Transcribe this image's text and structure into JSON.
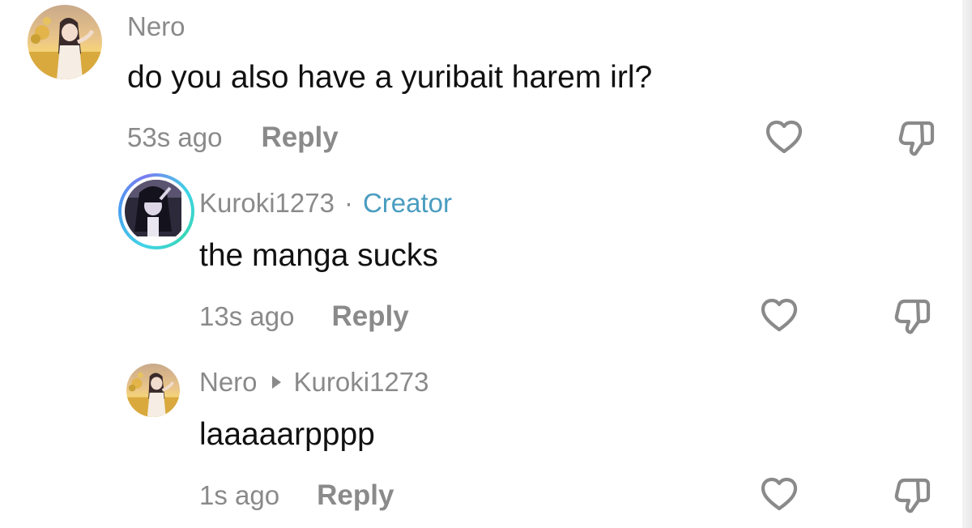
{
  "comments": [
    {
      "username": "Nero",
      "text": "do you also have a yuribait harem irl?",
      "time": "53s ago",
      "reply_label": "Reply",
      "avatar_icon": "anime-girl-sunset-avatar",
      "like_icon": "heart-outline-icon",
      "dislike_icon": "thumbs-down-outline-icon"
    },
    {
      "username": "Kuroki1273",
      "separator": "·",
      "badge": "Creator",
      "text": "the manga sucks",
      "time": "13s ago",
      "reply_label": "Reply",
      "avatar_icon": "anime-girl-dark-avatar",
      "like_icon": "heart-outline-icon",
      "dislike_icon": "thumbs-down-outline-icon"
    },
    {
      "username": "Nero",
      "reply_to": "Kuroki1273",
      "text": "laaaaarpppp",
      "time": "1s ago",
      "reply_label": "Reply",
      "avatar_icon": "anime-girl-sunset-avatar",
      "like_icon": "heart-outline-icon",
      "dislike_icon": "thumbs-down-outline-icon"
    }
  ],
  "colors": {
    "muted_text": "#8a8a8a",
    "body_text": "#111111",
    "creator_badge": "#4a9cc0",
    "story_ring_start": "#3fd3e6",
    "story_ring_end": "#7a7cf0"
  }
}
